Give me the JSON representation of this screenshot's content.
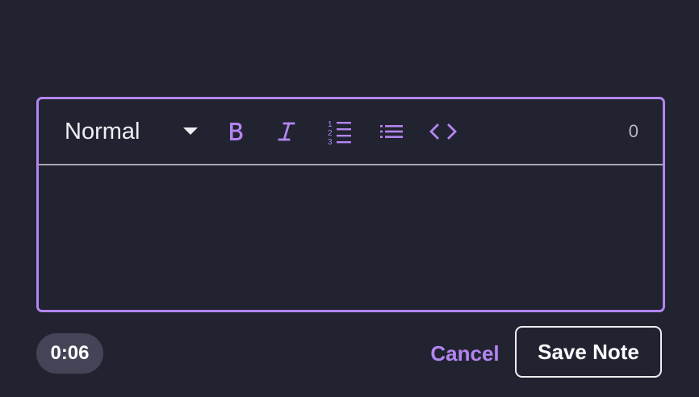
{
  "editor": {
    "format": {
      "selected": "Normal"
    },
    "toolbar": {
      "bold_icon": "bold-icon",
      "italic_icon": "italic-icon",
      "ordered_list_icon": "ordered-list-icon",
      "bullet_list_icon": "bullet-list-icon",
      "code_icon": "code-icon"
    },
    "character_count": "0",
    "content": ""
  },
  "footer": {
    "timer": "0:06",
    "cancel_label": "Cancel",
    "save_label": "Save Note"
  },
  "colors": {
    "background": "#222331",
    "accent": "#b385f0",
    "text": "#ededf2",
    "timer_bg": "#434557"
  }
}
